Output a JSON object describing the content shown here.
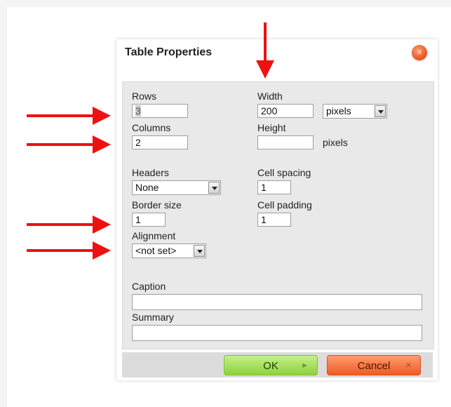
{
  "dialog": {
    "title": "Table Properties",
    "close_glyph": "✕"
  },
  "fields": {
    "rows": {
      "label": "Rows",
      "value": "3"
    },
    "columns": {
      "label": "Columns",
      "value": "2"
    },
    "width": {
      "label": "Width",
      "value": "200",
      "unit": "pixels"
    },
    "height": {
      "label": "Height",
      "value": "",
      "unit": "pixels"
    },
    "headers": {
      "label": "Headers",
      "value": "None"
    },
    "border_size": {
      "label": "Border size",
      "value": "1"
    },
    "alignment": {
      "label": "Alignment",
      "value": "<not set>"
    },
    "cell_spacing": {
      "label": "Cell spacing",
      "value": "1"
    },
    "cell_padding": {
      "label": "Cell padding",
      "value": "1"
    },
    "caption": {
      "label": "Caption",
      "value": ""
    },
    "summary": {
      "label": "Summary",
      "value": ""
    }
  },
  "buttons": {
    "ok": {
      "label": "OK",
      "glyph": "►"
    },
    "cancel": {
      "label": "Cancel",
      "glyph": "✕"
    }
  },
  "annotations": {
    "arrow_color": "#ee1111"
  }
}
